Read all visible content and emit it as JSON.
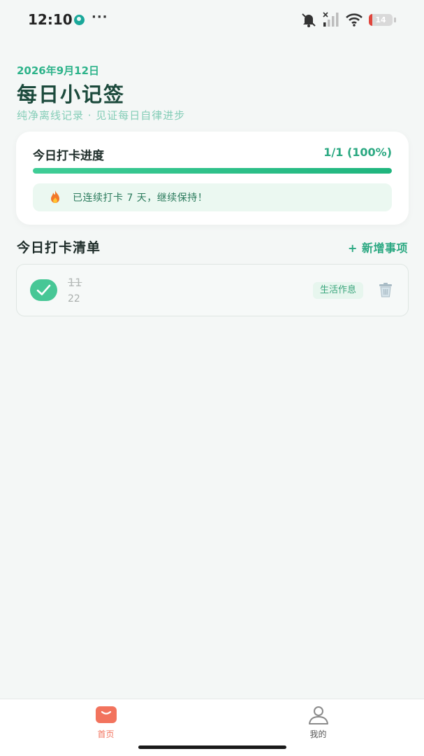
{
  "status_bar": {
    "time": "12:10",
    "more": "···",
    "battery_level": "14",
    "battery_fraction": 0.14,
    "icons": [
      "globe-icon",
      "bell-muted-icon",
      "signal-icon",
      "wifi-icon",
      "battery-icon"
    ]
  },
  "header": {
    "date": "2026年9月12日",
    "title": "每日小记签",
    "subtitle": "纯净离线记录 · 见证每日自律进步"
  },
  "progress_card": {
    "title": "今日打卡进度",
    "value": "1/1 (100%)",
    "fraction": 1.0,
    "streak_text": "已连续打卡 7 天，继续保持！",
    "streak_icon": "fire-icon"
  },
  "checklist": {
    "title": "今日打卡清单",
    "add_label": "+ 新增事项",
    "items": [
      {
        "name": "11",
        "note": "22",
        "tag": "生活作息",
        "done": true
      }
    ]
  },
  "tabbar": {
    "home_label": "首页",
    "mine_label": "我的",
    "active": "home"
  },
  "colors": {
    "accent": "#2aa881",
    "title": "#1c4a3c",
    "check": "#47c796",
    "tab_active": "#f2735d",
    "background": "#f4f7f6"
  }
}
